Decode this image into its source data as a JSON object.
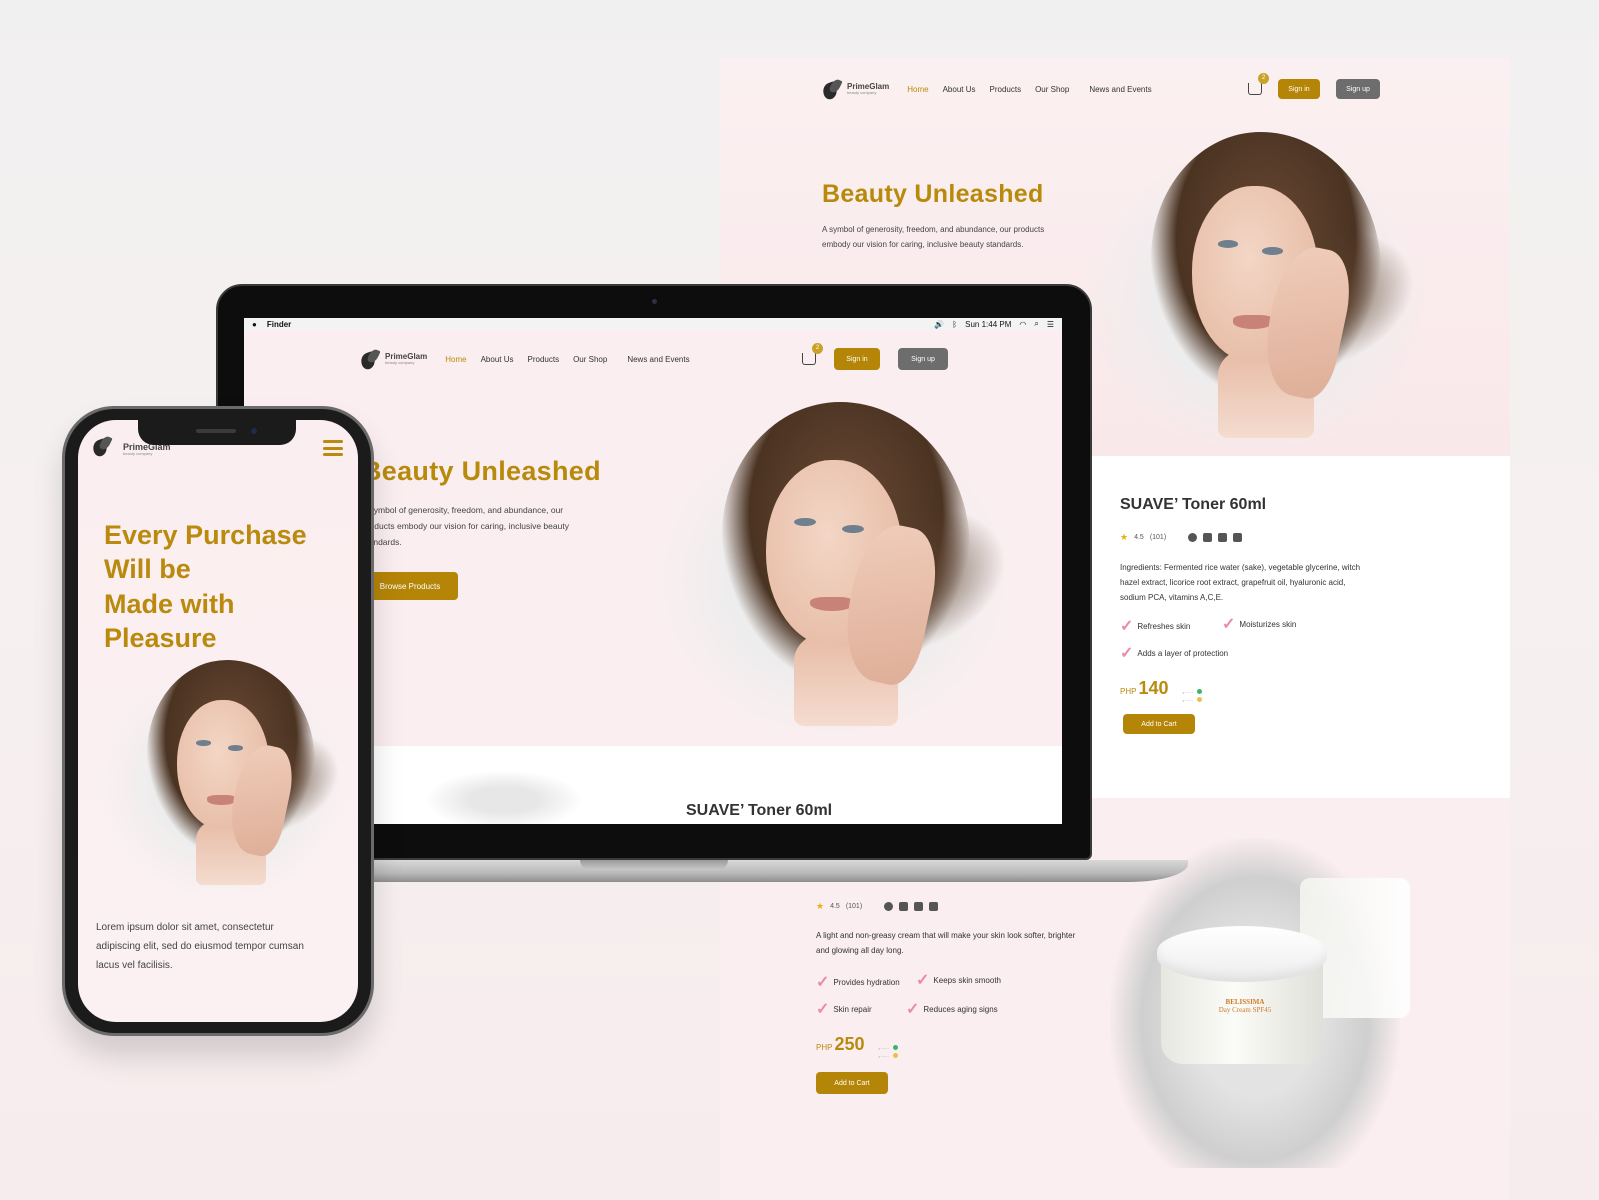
{
  "brand": {
    "name": "PrimeGlam",
    "tagline": "beauty company"
  },
  "nav": {
    "links": [
      "Home",
      "About Us",
      "Products",
      "Our Shop",
      "News and Events"
    ],
    "active": "Home",
    "cart_count": "2",
    "signin": "Sign in",
    "signup": "Sign up"
  },
  "hero": {
    "title": "Beauty Unleashed",
    "description": "A symbol of generosity, freedom, and abundance, our products embody our vision for caring, inclusive beauty standards.",
    "cta": "Browse Products"
  },
  "macos_menubar": {
    "app": "Finder",
    "clock": "Sun 1:44 PM"
  },
  "product_toner": {
    "name": "SUAVE’ Toner 60ml",
    "rating": "4.5",
    "reviews": "(101)",
    "ingredients": "Ingredients: Fermented rice water (sake), vegetable glycerine, witch hazel extract, licorice root extract, grapefruit oil, hyaluronic acid, sodium PCA, vitamins A,C,E.",
    "benefits": [
      "Refreshes skin",
      "Moisturizes skin",
      "Adds a layer of protection"
    ],
    "currency": "PHP",
    "price": "140",
    "cta": "Add to Cart"
  },
  "product_cream": {
    "rating": "4.5",
    "reviews": "(101)",
    "description": "A light and non-greasy cream that will make your skin look softer, brighter and glowing all day long.",
    "benefits": [
      "Provides hydration",
      "Keeps skin smooth",
      "Skin repair",
      "Reduces aging signs"
    ],
    "currency": "PHP",
    "price": "250",
    "cta": "Add to Cart",
    "jar_label_brand": "BELISSIMA",
    "jar_label_name": "Day Cream SPF45"
  },
  "laptop_peek_title": "SUAVE’ Toner 60ml",
  "mobile": {
    "headline": [
      "Every Purchase",
      "Will be",
      "Made with",
      "Pleasure"
    ],
    "body": "Lorem ipsum dolor sit amet, consectetur adipiscing elit, sed do eiusmod tempor cumsan lacus vel facilisis."
  },
  "colors": {
    "gold": "#b98a0e",
    "gold_button": "#b58507",
    "gray_button": "#6d6d6d",
    "pink_bg": "#fbeef0",
    "check_pink": "#e88ca8"
  }
}
